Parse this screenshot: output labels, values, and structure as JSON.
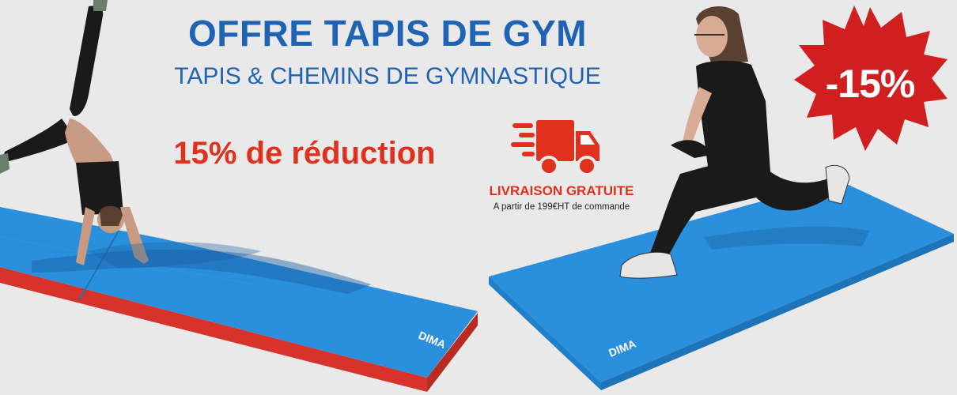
{
  "banner": {
    "title": "OFFRE TAPIS DE GYM",
    "subtitle": "TAPIS & CHEMINS DE GYMNASTIQUE",
    "discount_text": "15% de réduction",
    "shipping": {
      "title": "LIVRAISON GRATUITE",
      "note": "A partir de 199€HT de commande",
      "icon": "delivery-truck-icon"
    },
    "badge": {
      "text": "-15%",
      "icon": "starburst-badge"
    },
    "mat_brand": "DIMA",
    "colors": {
      "title_blue": "#1f63b5",
      "promo_red": "#e0301e",
      "mat_blue": "#2a8fdc",
      "mat_red_edge": "#d8332a",
      "background": "#e9e9e9"
    }
  }
}
